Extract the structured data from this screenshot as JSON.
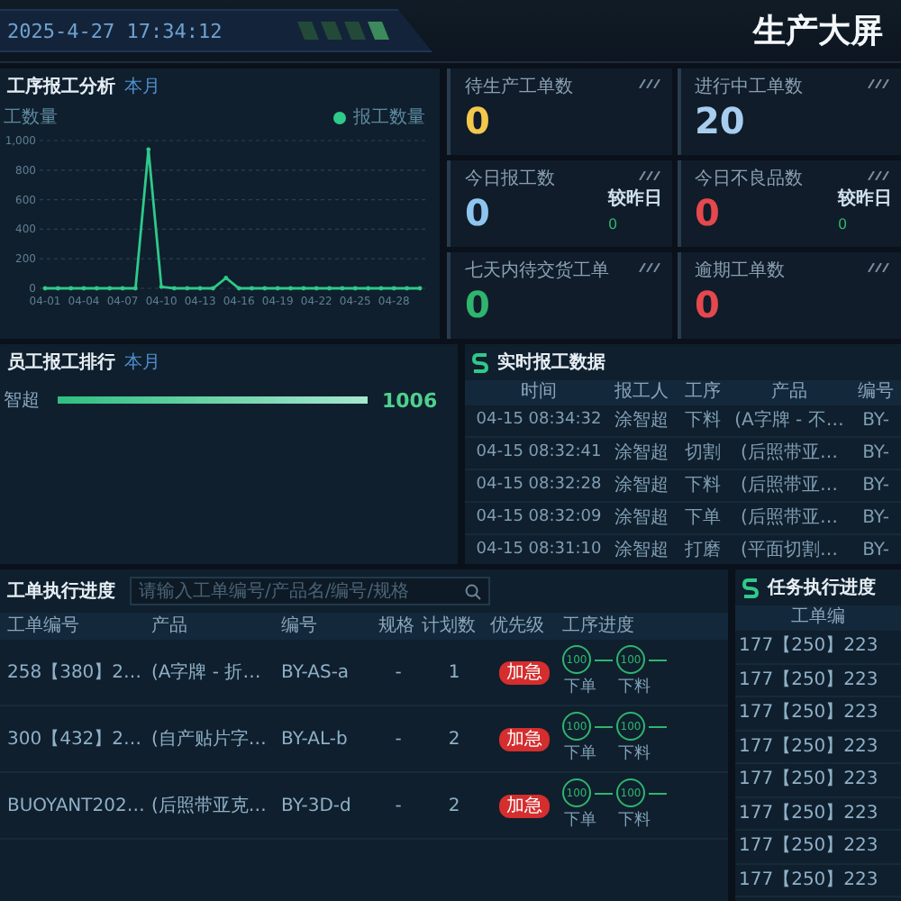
{
  "header": {
    "datetime": "2025-4-27 17:34:12",
    "title": "生产大屏"
  },
  "process_report": {
    "title": "工序报工分析",
    "period": "本月",
    "axis_title": "工数量",
    "chart_data": {
      "type": "line",
      "grid": true,
      "categories": [
        "04-01",
        null,
        null,
        "04-04",
        null,
        null,
        "04-07",
        null,
        null,
        "04-10",
        null,
        null,
        "04-13",
        null,
        null,
        "04-16",
        null,
        null,
        "04-19",
        null,
        null,
        "04-22",
        null,
        null,
        "04-25",
        null,
        null,
        "04-28",
        null,
        null
      ],
      "series": [
        {
          "name": "报工数量",
          "color": "#2fc98a",
          "values": [
            0,
            0,
            0,
            0,
            0,
            0,
            0,
            0,
            940,
            10,
            0,
            0,
            0,
            0,
            70,
            0,
            0,
            0,
            0,
            0,
            0,
            0,
            0,
            0,
            0,
            0,
            0,
            0,
            0,
            0
          ]
        }
      ],
      "ylim": [
        0,
        1000
      ],
      "yticks": [
        0,
        200,
        400,
        600,
        800,
        {
          "value": 1000,
          "label": "1,000"
        }
      ]
    }
  },
  "stats": [
    {
      "label": "待生产工单数",
      "value": "0",
      "color": "#f2c94c"
    },
    {
      "label": "进行中工单数",
      "value": "20",
      "color": "#a9cdee"
    },
    {
      "label": "今日报工数",
      "value": "0",
      "color": "#8ec5ee",
      "compare_label": "较昨日",
      "compare_value": "0"
    },
    {
      "label": "今日不良品数",
      "value": "0",
      "color": "#e5484d",
      "compare_label": "较昨日",
      "compare_value": "0"
    },
    {
      "label": "七天内待交货工单",
      "value": "0",
      "color": "#2fb56e"
    },
    {
      "label": "逾期工单数",
      "value": "0",
      "color": "#e5484d"
    }
  ],
  "employee_ranking": {
    "title": "员工报工排行",
    "period": "本月",
    "rows": [
      {
        "name": "智超",
        "level": 1,
        "value": "1006"
      }
    ]
  },
  "realtime_reports": {
    "title": "实时报工数据",
    "columns": [
      "时间",
      "报工人",
      "工序",
      "产品",
      "编号"
    ],
    "rows": [
      [
        "04-15 08:34:32",
        "涂智超",
        "下料",
        "(A字牌 - 不…",
        "BY-"
      ],
      [
        "04-15 08:32:41",
        "涂智超",
        "切割",
        "(后照带亚…",
        "BY-"
      ],
      [
        "04-15 08:32:28",
        "涂智超",
        "下料",
        "(后照带亚…",
        "BY-"
      ],
      [
        "04-15 08:32:09",
        "涂智超",
        "下单",
        "(后照带亚…",
        "BY-"
      ],
      [
        "04-15 08:31:10",
        "涂智超",
        "打磨",
        "(平面切割…",
        "BY-"
      ]
    ]
  },
  "work_orders": {
    "title": "工单执行进度",
    "search": {
      "placeholder": "请输入工单编号/产品名/编号/规格"
    },
    "columns": [
      "工单编号",
      "产品",
      "编号",
      "规格",
      "计划数",
      "优先级",
      "工序进度"
    ],
    "rows": [
      {
        "order": "258【380】2…",
        "product": "(A字牌 - 折…",
        "code": "BY-AS-a",
        "spec": "-",
        "planned": "1",
        "priority": "加急",
        "steps": [
          {
            "value": "100",
            "label": "下单"
          },
          {
            "value": "100",
            "label": "下料"
          }
        ]
      },
      {
        "order": "300【432】2…",
        "product": "(自产贴片字…",
        "code": "BY-AL-b",
        "spec": "-",
        "planned": "2",
        "priority": "加急",
        "steps": [
          {
            "value": "100",
            "label": "下单"
          },
          {
            "value": "100",
            "label": "下料"
          }
        ]
      },
      {
        "order": "BUOYANT202…",
        "product": "(后照带亚克…",
        "code": "BY-3D-d",
        "spec": "-",
        "planned": "2",
        "priority": "加急",
        "steps": [
          {
            "value": "100",
            "label": "下单"
          },
          {
            "value": "100",
            "label": "下料"
          }
        ]
      }
    ]
  },
  "task_progress": {
    "title": "任务执行进度",
    "column": "工单编",
    "rows": [
      "177【250】223",
      "177【250】223",
      "177【250】223",
      "177【250】223",
      "177【250】223",
      "177【250】223",
      "177【250】223",
      "177【250】223"
    ]
  }
}
